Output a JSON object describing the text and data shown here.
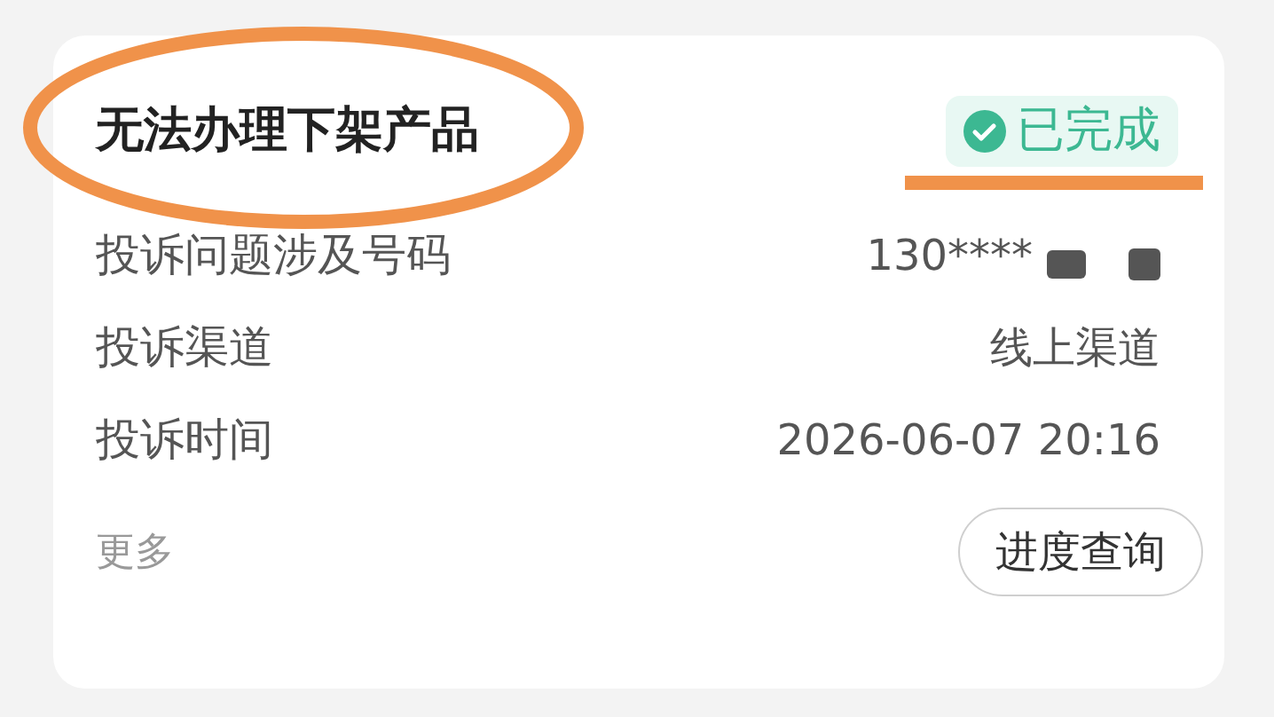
{
  "card": {
    "title": "无法办理下架产品",
    "status": {
      "label": "已完成",
      "kind": "completed"
    },
    "fields": [
      {
        "label": "投诉问题涉及号码",
        "value": "130****",
        "redacted": true
      },
      {
        "label": "投诉渠道",
        "value": "线上渠道",
        "redacted": false
      },
      {
        "label": "投诉时间",
        "value": "2026-06-07 20:16",
        "redacted": false
      }
    ],
    "more": "更多",
    "button": "进度查询"
  },
  "annotations": [
    {
      "kind": "ellipse"
    },
    {
      "kind": "underline"
    }
  ]
}
